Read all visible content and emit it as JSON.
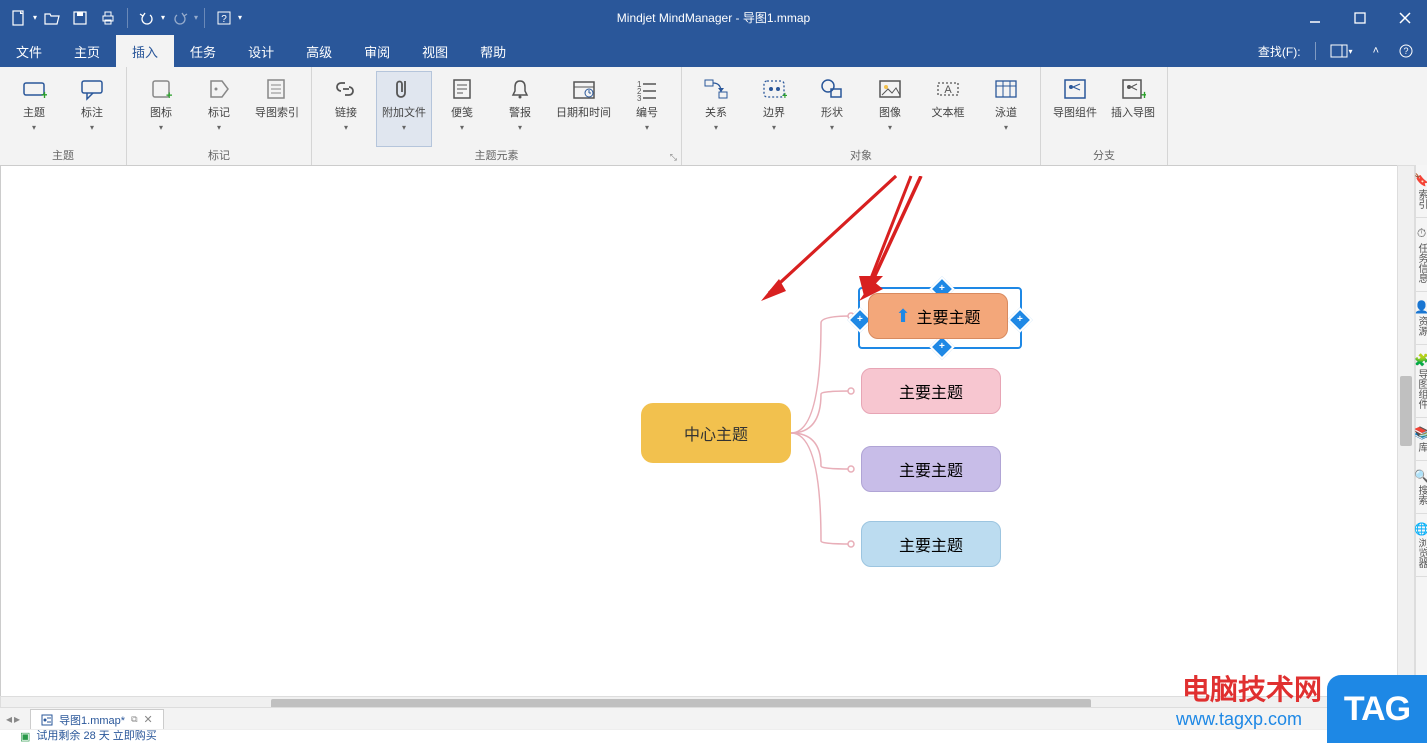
{
  "app": {
    "title": "Mindjet MindManager - 导图1.mmap"
  },
  "qat": {
    "items": [
      "new",
      "open",
      "save",
      "print",
      "undo",
      "redo",
      "help"
    ]
  },
  "menu": {
    "items": [
      "文件",
      "主页",
      "插入",
      "任务",
      "设计",
      "高级",
      "审阅",
      "视图",
      "帮助"
    ],
    "active_index": 2,
    "right": {
      "find_label": "查找(F):"
    }
  },
  "ribbon": {
    "groups": [
      {
        "label": "主题",
        "buttons": [
          {
            "label": "主题",
            "icon": "topic-icon",
            "dd": true
          },
          {
            "label": "标注",
            "icon": "callout-icon",
            "dd": true
          }
        ]
      },
      {
        "label": "标记",
        "buttons": [
          {
            "label": "图标",
            "icon": "marker-icon",
            "dd": true
          },
          {
            "label": "标记",
            "icon": "tag-icon",
            "dd": true
          },
          {
            "label": "导图索引",
            "icon": "index-icon"
          }
        ]
      },
      {
        "label": "主题元素",
        "launcher": true,
        "buttons": [
          {
            "label": "链接",
            "icon": "link-icon",
            "dd": true
          },
          {
            "label": "附加文件",
            "icon": "attachment-icon",
            "dd": true,
            "active": true
          },
          {
            "label": "便笺",
            "icon": "notes-icon",
            "dd": true
          },
          {
            "label": "警报",
            "icon": "alert-icon",
            "dd": true
          },
          {
            "label": "日期和时间",
            "icon": "datetime-icon"
          },
          {
            "label": "编号",
            "icon": "numbering-icon",
            "dd": true
          }
        ]
      },
      {
        "label": "对象",
        "buttons": [
          {
            "label": "关系",
            "icon": "relation-icon",
            "dd": true
          },
          {
            "label": "边界",
            "icon": "boundary-icon",
            "dd": true
          },
          {
            "label": "形状",
            "icon": "shape-icon",
            "dd": true
          },
          {
            "label": "图像",
            "icon": "image-icon",
            "dd": true
          },
          {
            "label": "文本框",
            "icon": "textbox-icon"
          },
          {
            "label": "泳道",
            "icon": "swimlane-icon",
            "dd": true
          }
        ]
      },
      {
        "label": "分支",
        "buttons": [
          {
            "label": "导图组件",
            "icon": "mapparts-icon"
          },
          {
            "label": "插入导图",
            "icon": "insertmap-icon"
          }
        ]
      }
    ]
  },
  "mindmap": {
    "central": "中心主题",
    "selected_attachment_indicator": "⬆",
    "nodes": [
      {
        "label": "主要主题",
        "color": "sub1",
        "selected": true,
        "has_attachment_arrow": true
      },
      {
        "label": "主要主题",
        "color": "sub2"
      },
      {
        "label": "主要主题",
        "color": "sub3"
      },
      {
        "label": "主要主题",
        "color": "sub4"
      }
    ]
  },
  "side_tabs": [
    "索引",
    "任务信息",
    "资源",
    "导图组件",
    "库",
    "搜索",
    "浏览器"
  ],
  "doc_tab": {
    "name": "导图1.mmap*"
  },
  "status": {
    "text": "试用剩余 28 天   立即购买"
  },
  "watermark": {
    "line1": "电脑技术网",
    "line2": "www.tagxp.com",
    "tag": "TAG"
  }
}
